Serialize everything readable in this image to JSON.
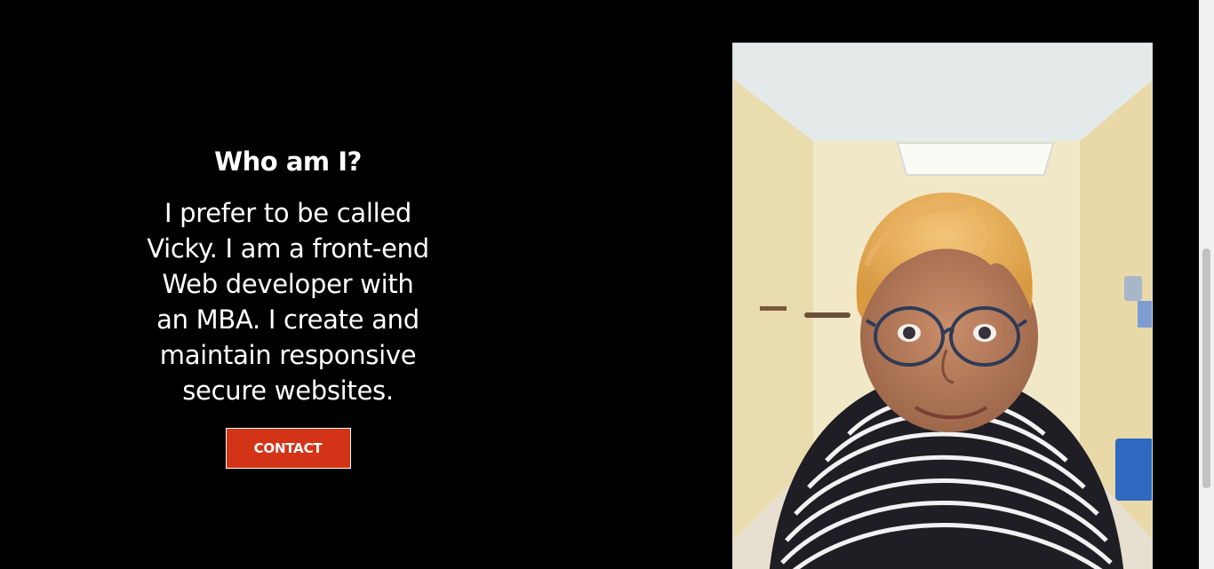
{
  "about": {
    "heading": "Who am I?",
    "description": "I prefer to be called Vicky. I am a front-end Web developer with an MBA. I create and maintain responsive secure websites.",
    "contact_label": "CONTACT"
  },
  "photo": {
    "alt": "Portrait of Vicky"
  },
  "colors": {
    "background": "#000000",
    "accent": "#d33317",
    "text": "#ffffff"
  }
}
